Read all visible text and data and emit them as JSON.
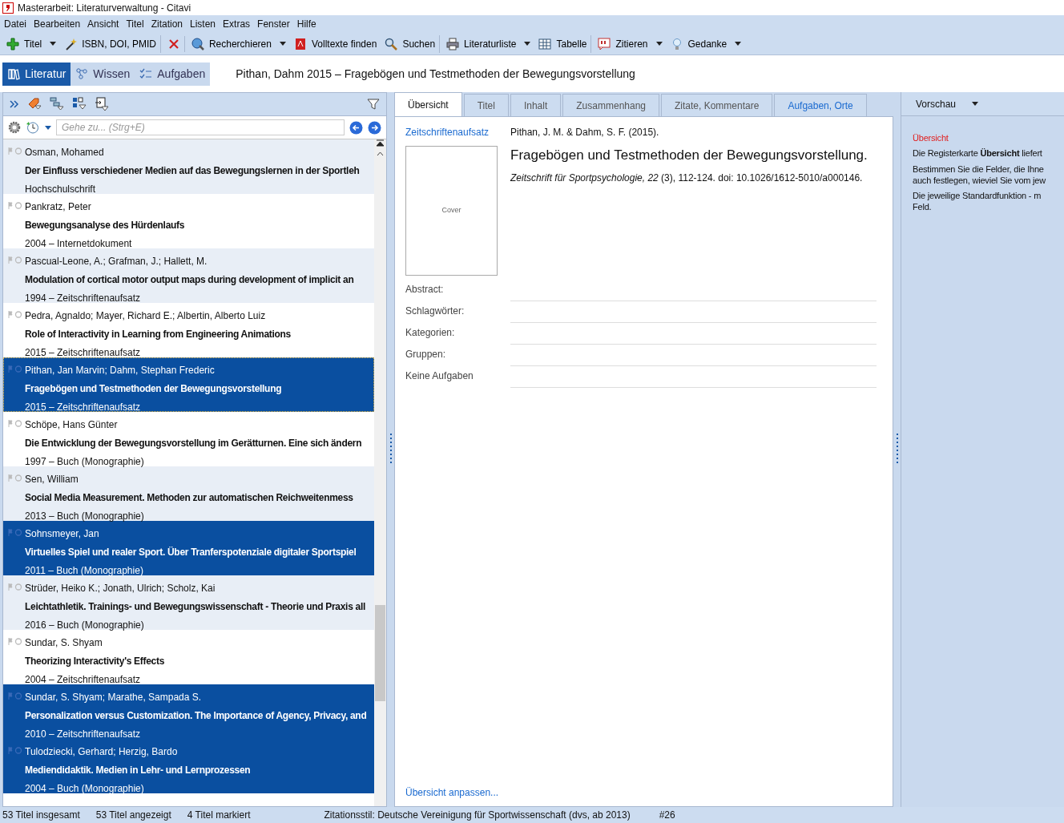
{
  "window": {
    "title": "Masterarbeit: Literaturverwaltung - Citavi"
  },
  "menu": [
    "Datei",
    "Bearbeiten",
    "Ansicht",
    "Titel",
    "Zitation",
    "Listen",
    "Extras",
    "Fenster",
    "Hilfe"
  ],
  "toolbar": [
    {
      "label": "Titel",
      "dropdown": true,
      "separator_after": false
    },
    {
      "label": "ISBN, DOI, PMID",
      "dropdown": false,
      "separator_after": true
    },
    {
      "dropdown": false,
      "separator_after": true
    },
    {
      "label": "Recherchieren",
      "dropdown": true,
      "separator_after": false
    },
    {
      "label": "Volltexte finden",
      "dropdown": false,
      "separator_after": false
    },
    {
      "label": "Suchen",
      "dropdown": false,
      "separator_after": true
    },
    {
      "label": "Literaturliste",
      "dropdown": true,
      "separator_after": false
    },
    {
      "label": "Tabelle",
      "dropdown": false,
      "separator_after": true
    },
    {
      "label": "Zitieren",
      "dropdown": true,
      "separator_after": false
    },
    {
      "label": "Gedanke",
      "dropdown": true,
      "separator_after": false
    }
  ],
  "modes": [
    {
      "label": "Literatur",
      "selected": true
    },
    {
      "label": "Wissen",
      "selected": false
    },
    {
      "label": "Aufgaben",
      "selected": false
    }
  ],
  "current_title": "Pithan, Dahm 2015 – Fragebögen und Testmethoden der Bewegungsvorstellung",
  "goto": {
    "placeholder": "Gehe zu... (Strg+E)"
  },
  "references": [
    {
      "authors": "Osman, Mohamed",
      "title": "Der Einfluss verschiedener Medien auf das Bewegungslernen in der Sportleh",
      "meta": "Hochschulschrift",
      "selected": false,
      "focused": false
    },
    {
      "authors": "Pankratz, Peter",
      "title": "Bewegungsanalyse des Hürdenlaufs",
      "meta": "2004 – Internetdokument",
      "selected": false,
      "focused": false
    },
    {
      "authors": "Pascual-Leone, A.; Grafman, J.; Hallett, M.",
      "title": "Modulation of cortical motor output maps during development of implicit an",
      "meta": "1994 – Zeitschriftenaufsatz",
      "selected": false,
      "focused": false
    },
    {
      "authors": "Pedra, Agnaldo; Mayer, Richard E.; Albertin, Alberto Luiz",
      "title": "Role of Interactivity in Learning from Engineering Animations",
      "meta": "2015 – Zeitschriftenaufsatz",
      "selected": false,
      "focused": false
    },
    {
      "authors": "Pithan, Jan Marvin; Dahm, Stephan Frederic",
      "title": "Fragebögen und Testmethoden der Bewegungsvorstellung",
      "meta": "2015 – Zeitschriftenaufsatz",
      "selected": true,
      "focused": true
    },
    {
      "authors": "Schöpe, Hans Günter",
      "title": "Die Entwicklung der Bewegungsvorstellung im Gerätturnen. Eine sich ändern",
      "meta": "1997 – Buch (Monographie)",
      "selected": false,
      "focused": false
    },
    {
      "authors": "Sen, William",
      "title": "Social Media Measurement. Methoden zur automatischen Reichweitenmess",
      "meta": "2013 – Buch (Monographie)",
      "selected": false,
      "focused": false
    },
    {
      "authors": "Sohnsmeyer, Jan",
      "title": "Virtuelles Spiel und realer Sport. Über Tranferspotenziale digitaler Sportspiel",
      "meta": "2011 – Buch (Monographie)",
      "selected": true,
      "focused": false
    },
    {
      "authors": "Strüder, Heiko K.; Jonath, Ulrich; Scholz, Kai",
      "title": "Leichtathletik. Trainings- und Bewegungswissenschaft - Theorie und Praxis all",
      "meta": "2016 – Buch (Monographie)",
      "selected": false,
      "focused": false
    },
    {
      "authors": "Sundar, S. Shyam",
      "title": "Theorizing Interactivity's Effects",
      "meta": "2004 – Zeitschriftenaufsatz",
      "selected": false,
      "focused": false
    },
    {
      "authors": "Sundar, S. Shyam; Marathe, Sampada S.",
      "title": "Personalization versus Customization. The Importance of Agency, Privacy, and",
      "meta": "2010 – Zeitschriftenaufsatz",
      "selected": true,
      "focused": false
    },
    {
      "authors": "Tulodziecki, Gerhard; Herzig, Bardo",
      "title": "Mediendidaktik. Medien in Lehr- und Lernprozessen",
      "meta": "2004 – Buch (Monographie)",
      "selected": true,
      "focused": false
    }
  ],
  "tabs": [
    {
      "label": "Übersicht",
      "selected": true,
      "has_content": false
    },
    {
      "label": "Titel",
      "selected": false,
      "has_content": false
    },
    {
      "label": "Inhalt",
      "selected": false,
      "has_content": false
    },
    {
      "label": "Zusammenhang",
      "selected": false,
      "has_content": false
    },
    {
      "label": "Zitate, Kommentare",
      "selected": false,
      "has_content": false
    },
    {
      "label": "Aufgaben, Orte",
      "selected": false,
      "has_content": true
    }
  ],
  "overview": {
    "type": "Zeitschriftenaufsatz",
    "cover": "Cover",
    "citation_authors": "Pithan, J. M. & Dahm, S. F. (2015).",
    "citation_title": "Fragebögen und Testmethoden der Bewegungsvorstellung.",
    "citation_source": "*Zeitschrift für Sportpsychologie, 22* (3), 112-124. doi: 10.1026/1612-5010/a000146.",
    "fields": [
      "Abstract:",
      "Schlagwörter:",
      "Kategorien:",
      "Gruppen:",
      "Keine Aufgaben"
    ],
    "customize": "Übersicht anpassen..."
  },
  "preview": {
    "label": "Vorschau",
    "heading": "Übersicht",
    "paragraphs": [
      [
        "Die Registerkarte **Übersicht** liefert"
      ],
      [
        "Bestimmen Sie die Felder, die Ihne",
        "auch festlegen, wieviel Sie vom jew"
      ],
      [
        "Die jeweilige Standardfunktion - m",
        "Feld."
      ]
    ]
  },
  "status_bar": [
    "53 Titel insgesamt",
    "53 Titel angezeigt",
    "4 Titel markiert",
    "Zitationsstil: Deutsche Vereinigung für Sportwissenschaft (dvs, ab 2013)",
    "#26"
  ]
}
